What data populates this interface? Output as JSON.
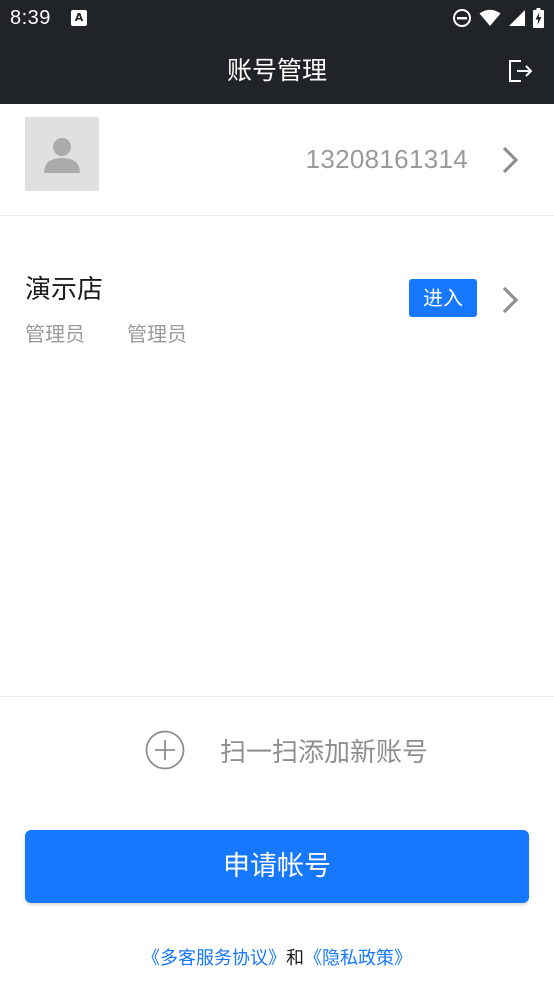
{
  "status_bar": {
    "time": "8:39",
    "notification_glyph": "A",
    "icons": [
      "do-not-disturb-icon",
      "wifi-icon",
      "signal-icon",
      "battery-charging-icon"
    ]
  },
  "header": {
    "title": "账号管理",
    "logout_icon": "logout-icon"
  },
  "account": {
    "phone": "13208161314"
  },
  "store": {
    "name": "演示店",
    "roles": [
      "管理员",
      "管理员"
    ],
    "enter_label": "进入"
  },
  "scan": {
    "label": "扫一扫添加新账号"
  },
  "apply_button": {
    "label": "申请帐号"
  },
  "footer": {
    "link1": "《多客服务协议》",
    "conjunction": "和",
    "link2": "《隐私政策》"
  },
  "colors": {
    "header_bg": "#202327",
    "accent": "#1677ff",
    "muted_text": "#9a9a9a",
    "avatar_bg": "#e0e0e0"
  }
}
